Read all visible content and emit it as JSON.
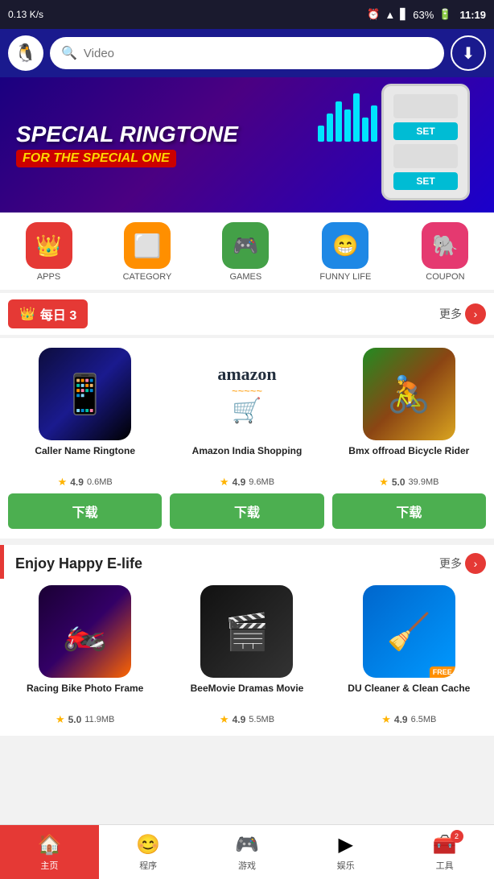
{
  "statusBar": {
    "speed": "0.13 K/s",
    "battery": "63%",
    "time": "11:19"
  },
  "header": {
    "search_placeholder": "Video",
    "avatar_emoji": "🐧"
  },
  "banner": {
    "line1": "SPECIAL RINGTONE",
    "line2": "FOR THE SPECIAL ONE",
    "set1": "SET",
    "set2": "SET"
  },
  "categories": [
    {
      "id": "apps",
      "label": "APPS",
      "icon": "👑",
      "color": "red"
    },
    {
      "id": "category",
      "label": "CATEGORY",
      "icon": "⬜",
      "color": "orange"
    },
    {
      "id": "games",
      "label": "GAMES",
      "icon": "🎮",
      "color": "green"
    },
    {
      "id": "funny-life",
      "label": "FUNNY LIFE",
      "icon": "😁",
      "color": "blue"
    },
    {
      "id": "coupon",
      "label": "COUPON",
      "icon": "🐘",
      "color": "pink"
    }
  ],
  "daily": {
    "title": "每日 3",
    "more": "更多"
  },
  "apps": [
    {
      "name": "Caller Name Ringtone",
      "rating": "4.9",
      "size": "0.6MB",
      "download": "下载",
      "icon_type": "caller"
    },
    {
      "name": "Amazon India Shopping",
      "rating": "4.9",
      "size": "9.6MB",
      "download": "下载",
      "icon_type": "amazon"
    },
    {
      "name": "Bmx offroad Bicycle Rider",
      "rating": "5.0",
      "size": "39.9MB",
      "download": "下载",
      "icon_type": "bmx"
    }
  ],
  "enjoy": {
    "title": "Enjoy Happy E-life",
    "more": "更多"
  },
  "enjoy_apps": [
    {
      "name": "Racing Bike Photo Frame",
      "rating": "5.0",
      "size": "11.9MB",
      "icon_type": "racing",
      "free": false
    },
    {
      "name": "BeeMovie Dramas Movie",
      "rating": "4.9",
      "size": "5.5MB",
      "icon_type": "beemovie",
      "free": false
    },
    {
      "name": "DU Cleaner & Clean Cache",
      "rating": "4.9",
      "size": "6.5MB",
      "icon_type": "ducleaner",
      "free": true,
      "free_label": "FREE"
    }
  ],
  "bottomNav": [
    {
      "id": "home",
      "label": "主页",
      "icon": "🏠",
      "active": true,
      "badge": null
    },
    {
      "id": "apps",
      "label": "程序",
      "icon": "😊",
      "active": false,
      "badge": null
    },
    {
      "id": "games",
      "label": "游戏",
      "icon": "🎮",
      "active": false,
      "badge": null
    },
    {
      "id": "entertainment",
      "label": "娱乐",
      "icon": "▶",
      "active": false,
      "badge": null
    },
    {
      "id": "tools",
      "label": "工具",
      "icon": "🧰",
      "active": false,
      "badge": "2"
    }
  ],
  "colors": {
    "red": "#e53935",
    "green": "#4CAF50",
    "orange": "#ff8f00"
  }
}
